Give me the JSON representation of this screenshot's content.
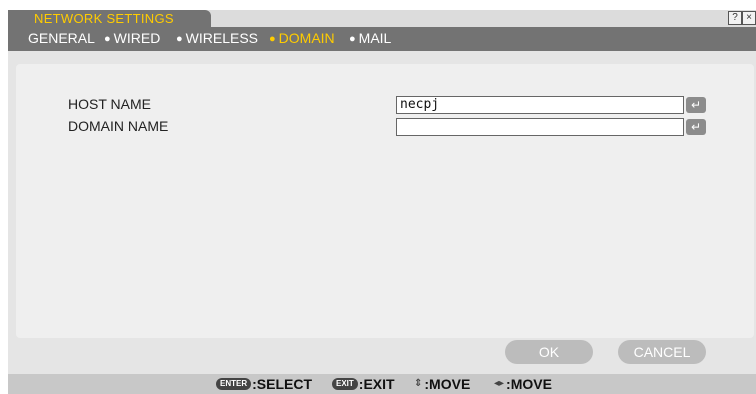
{
  "window": {
    "title": "NETWORK SETTINGS",
    "help_button": "?",
    "close_button": "×"
  },
  "tabs": [
    {
      "label": "GENERAL",
      "active": false
    },
    {
      "label": "WIRED",
      "active": false
    },
    {
      "label": "WIRELESS",
      "active": false
    },
    {
      "label": "DOMAIN",
      "active": true
    },
    {
      "label": "MAIL",
      "active": false
    }
  ],
  "form": {
    "host_name_label": "HOST NAME",
    "host_name_value": "necpj",
    "domain_name_label": "DOMAIN NAME",
    "domain_name_value": "",
    "enter_symbol": "↵"
  },
  "buttons": {
    "ok": "OK",
    "cancel": "CANCEL"
  },
  "footer": {
    "enter_key": "ENTER",
    "select": ":SELECT",
    "exit_key": "EXIT",
    "exit": ":EXIT",
    "move_vertical_icon": "⇕",
    "move_vertical": ":MOVE",
    "move_horizontal_icon": "◂▸",
    "move_horizontal": ":MOVE"
  },
  "colors": {
    "accent": "#ffcc00",
    "tab_bar": "#737373",
    "panel": "#efefef",
    "button": "#bcbcbc"
  }
}
